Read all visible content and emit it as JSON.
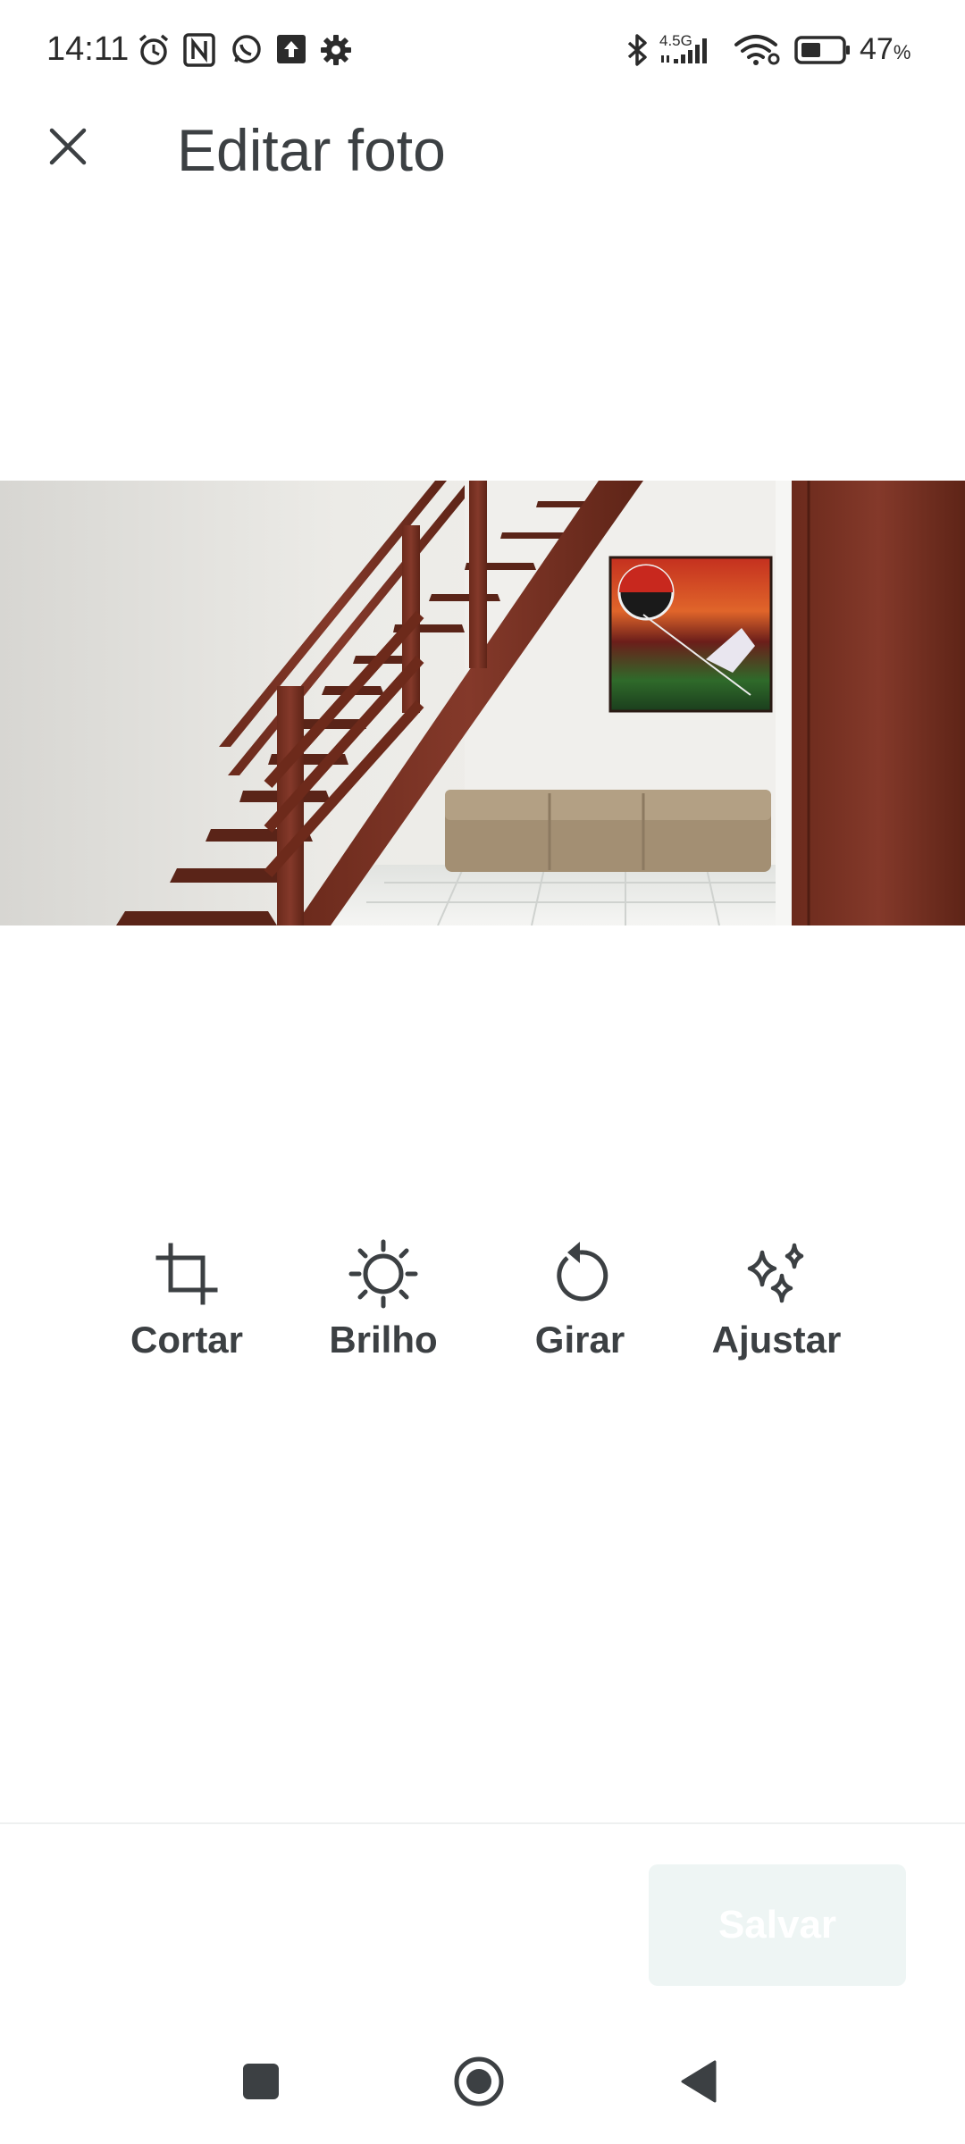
{
  "status_bar": {
    "time": "14:11",
    "network": "4.5G",
    "battery_percent": "47",
    "battery_unit": "%",
    "battery_level": 0.47,
    "left_icons": [
      "alarm-icon",
      "nfc-icon",
      "whatsapp-icon",
      "upload-icon",
      "settings-icon"
    ],
    "right_icons": [
      "bluetooth-icon",
      "cell-signal-icon",
      "wifi-icon",
      "battery-icon"
    ]
  },
  "app_bar": {
    "close_icon": "close-icon",
    "title": "Editar foto"
  },
  "photo": {
    "description_icon": "photo-preview"
  },
  "tools": [
    {
      "id": "crop",
      "label": "Cortar",
      "icon": "crop-icon"
    },
    {
      "id": "brightness",
      "label": "Brilho",
      "icon": "brightness-icon"
    },
    {
      "id": "rotate",
      "label": "Girar",
      "icon": "rotate-icon"
    },
    {
      "id": "adjust",
      "label": "Ajustar",
      "icon": "sparkle-icon"
    }
  ],
  "footer": {
    "save_label": "Salvar",
    "save_enabled": false
  },
  "navigation": {
    "items": [
      "recents-icon",
      "home-icon",
      "back-icon"
    ]
  },
  "colors": {
    "text": "#3c4043",
    "save_disabled_bg": "#eef5f4"
  }
}
